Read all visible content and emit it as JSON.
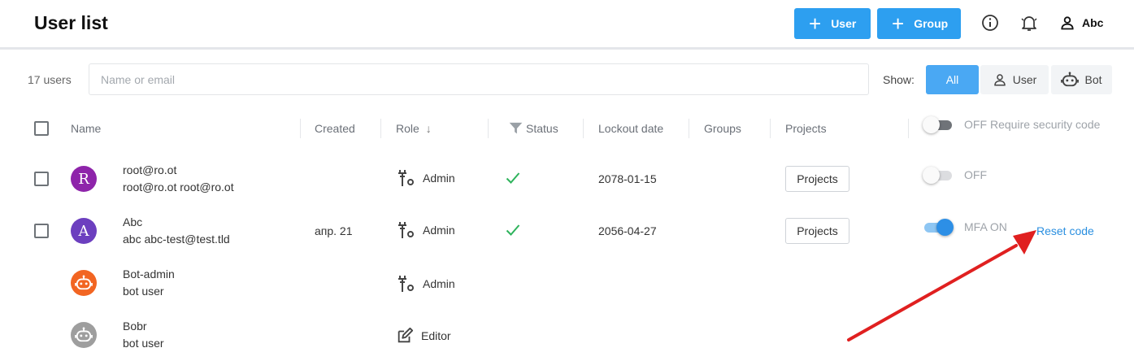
{
  "header": {
    "title": "User list",
    "add_user_label": "User",
    "add_group_label": "Group",
    "profile_name": "Abc"
  },
  "toolbar": {
    "count_text": "17 users",
    "search_placeholder": "Name or email",
    "search_value": "",
    "show_label": "Show:",
    "filters": [
      {
        "label": "All",
        "active": true
      },
      {
        "label": "User",
        "active": false,
        "icon": "person-icon"
      },
      {
        "label": "Bot",
        "active": false,
        "icon": "robot-icon"
      }
    ]
  },
  "table": {
    "columns": {
      "name": "Name",
      "created": "Created",
      "role": "Role",
      "status": "Status",
      "lockout": "Lockout date",
      "groups": "Groups",
      "projects": "Projects"
    },
    "security_toggle": {
      "state_label": "OFF",
      "label": "Require security code",
      "on": false
    },
    "rows": [
      {
        "avatar_letter": "R",
        "avatar_color": "#8e24aa",
        "type": "user",
        "name": "root@ro.ot",
        "subtitle": "root@ro.ot root@ro.ot",
        "created": "",
        "role": "Admin",
        "role_icon": "wrench-gear-icon",
        "status_ok": true,
        "lockout": "2078-01-15",
        "projects_label": "Projects",
        "mfa_label": "OFF",
        "mfa_on": false,
        "reset_label": ""
      },
      {
        "avatar_letter": "A",
        "avatar_color": "#6c3fbf",
        "type": "user",
        "name": "Abc",
        "subtitle": "abc abc-test@test.tld",
        "created": "апр. 21",
        "role": "Admin",
        "role_icon": "wrench-gear-icon",
        "status_ok": true,
        "lockout": "2056-04-27",
        "projects_label": "Projects",
        "mfa_label": "MFA ON",
        "mfa_on": true,
        "reset_label": "Reset code"
      },
      {
        "avatar_color": "#f26522",
        "type": "bot",
        "name": "Bot-admin",
        "subtitle": "bot user",
        "role": "Admin",
        "role_icon": "wrench-gear-icon"
      },
      {
        "avatar_color": "#9e9e9e",
        "type": "bot",
        "name": "Bobr",
        "subtitle": "bot user",
        "role": "Editor",
        "role_icon": "edit-icon"
      }
    ]
  },
  "colors": {
    "primary": "#2d9ff0",
    "status_ok": "#2eb35c",
    "link": "#2a8fe0",
    "annotation_arrow": "#e02020"
  }
}
